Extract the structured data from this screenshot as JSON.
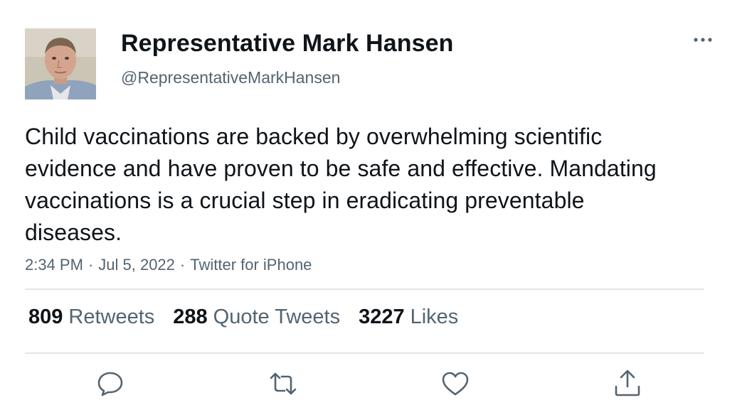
{
  "tweet": {
    "author": {
      "display_name": "Representative Mark Hansen",
      "handle": "@RepresentativeMarkHansen",
      "avatar_icon": "profile-photo"
    },
    "text": "Child vaccinations are backed by overwhelming scientific evidence and have proven to be safe and effective. Mandating vaccinations is a crucial step in eradicating preventable diseases.",
    "timestamp": {
      "time": "2:34 PM",
      "separator": "·",
      "date": "Jul 5, 2022",
      "source": "Twitter for iPhone"
    },
    "stats": {
      "retweets": {
        "count": "809",
        "label": "Retweets"
      },
      "quote_tweets": {
        "count": "288",
        "label": "Quote Tweets"
      },
      "likes": {
        "count": "3227",
        "label": "Likes"
      }
    },
    "actions": [
      {
        "name": "reply",
        "icon": "reply-icon"
      },
      {
        "name": "retweet",
        "icon": "retweet-icon"
      },
      {
        "name": "like",
        "icon": "heart-icon"
      },
      {
        "name": "share",
        "icon": "share-icon"
      }
    ],
    "colors": {
      "primary_text": "#0f1419",
      "secondary_text": "#536471",
      "divider": "#e1e5e8"
    }
  }
}
